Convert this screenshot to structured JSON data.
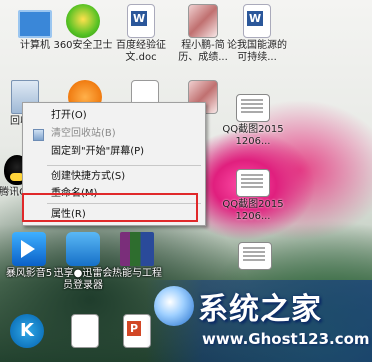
{
  "desktop_icons": {
    "computer": "计算机",
    "security360": "360安全卫士",
    "baidu_doc": "百度经验征文.doc",
    "cheng_xiao_peng": "程小鹏-简历、成绩...",
    "lun_wo_guo": "论我国能源的可持续...",
    "recycle_bin": "回收站",
    "qq_shot_1": "QQ截图20151206...",
    "qq_shot_2": "QQ截图20151206...",
    "tencent_qq": "腾讯QQ",
    "storm": "暴风影音5",
    "xunlei": "迅享●迅雷会员登录器",
    "winrar": "热能与工程",
    "kugou": "",
    "blank_doc": "",
    "ppt_doc": ""
  },
  "context_menu": {
    "open": "打开(O)",
    "empty_recycle": "清空回收站(B)",
    "pin_start": "固定到\"开始\"屏幕(P)",
    "create_shortcut": "创建快捷方式(S)",
    "rename": "重命名(M)",
    "properties": "属性(R)"
  },
  "watermark": {
    "title": "系统之家",
    "url": "www.Ghost123.com"
  },
  "colors": {
    "highlight_border": "#e0282a",
    "menu_bg": "#f2f2f2"
  }
}
